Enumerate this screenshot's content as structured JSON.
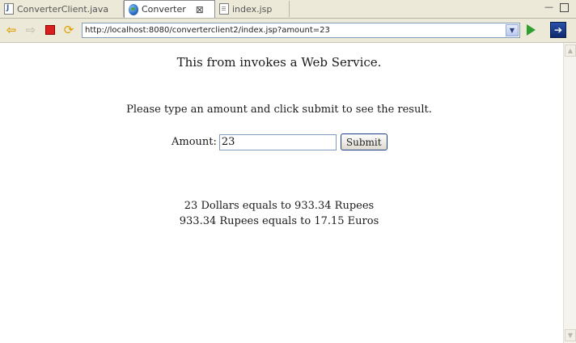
{
  "tabs": [
    {
      "label": "ConverterClient.java",
      "icon": "java-file-icon",
      "active": false
    },
    {
      "label": "Converter",
      "icon": "globe-icon",
      "active": true
    },
    {
      "label": "index.jsp",
      "icon": "jsp-file-icon",
      "active": false
    }
  ],
  "toolbar": {
    "url": "http://localhost:8080/converterclient2/index.jsp?amount=23"
  },
  "page": {
    "heading": "This from invokes a Web Service.",
    "instruction": "Please type an amount and click submit to see the result.",
    "amount_label": "Amount:",
    "amount_value": "23",
    "submit_label": "Submit",
    "result_line1": "23 Dollars equals to 933.34 Rupees",
    "result_line2": "933.34 Rupees equals to 17.15 Euros"
  },
  "colors": {
    "chrome_bg": "#ece9d8",
    "url_border": "#7f9db9",
    "submit_border": "#1f3f8a"
  }
}
